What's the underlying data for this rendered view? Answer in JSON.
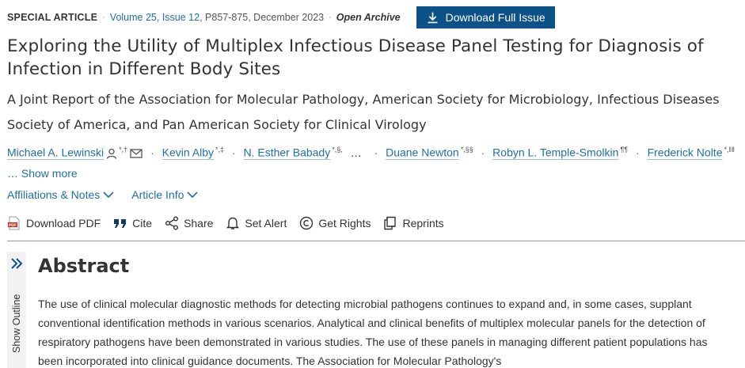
{
  "meta": {
    "article_type": "SPECIAL ARTICLE",
    "volume_issue": "Volume 25, Issue 12",
    "pages_date": ", P857-875, December 2023",
    "access": "Open Archive",
    "download_issue_label": "Download Full Issue"
  },
  "article": {
    "title": "Exploring the Utility of Multiplex Infectious Disease Panel Testing for Diagnosis of Infection in Different Body Sites",
    "subtitle": "A Joint Report of the Association for Molecular Pathology, American Society for Microbiology, Infectious Diseases Society of America, and Pan American Society for Clinical Virology"
  },
  "authors": [
    {
      "name": "Michael A. Lewinski",
      "sup": "*,†"
    },
    {
      "name": "Kevin Alby",
      "sup": "*,‡"
    },
    {
      "name": "N. Esther Babady",
      "sup": "*,§,"
    },
    {
      "name": "Duane Newton",
      "sup": "*,§§"
    },
    {
      "name": "Robyn L. Temple-Smolkin",
      "sup": "¶¶"
    },
    {
      "name": "Frederick Nolte",
      "sup": "*,‖‖"
    }
  ],
  "authors_ellipsis": "…",
  "show_more_label": "… Show more",
  "info": {
    "affiliations_label": "Affiliations & Notes",
    "article_info_label": "Article Info"
  },
  "tools": {
    "download_pdf": "Download PDF",
    "cite": "Cite",
    "share": "Share",
    "set_alert": "Set Alert",
    "get_rights": "Get Rights",
    "reprints": "Reprints"
  },
  "outline": {
    "label": "Show Outline"
  },
  "abstract": {
    "heading": "Abstract",
    "text": "The use of clinical molecular diagnostic methods for detecting microbial pathogens continues to expand and, in some cases, supplant conventional identification methods in various scenarios. Analytical and clinical benefits of multiplex molecular panels for the detection of respiratory pathogens have been demonstrated in various studies. The use of these panels in managing different patient populations has been incorporated into clinical guidance documents. The Association for Molecular Pathology's"
  },
  "colors": {
    "link": "#1f6ea6",
    "button_bg": "#0c5288",
    "text": "#333333",
    "pdf_red": "#d9261c"
  }
}
